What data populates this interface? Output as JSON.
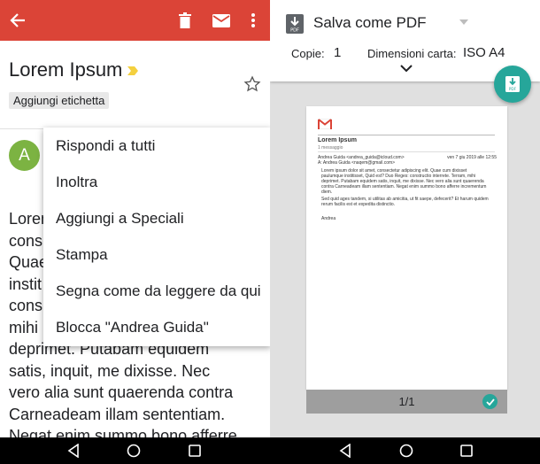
{
  "left": {
    "subject": "Lorem Ipsum",
    "label_chip": "Aggiungi etichetta",
    "avatar_letter": "A",
    "body": "Lorem\ncons\nQuae\ninstit\ncons\nmihi\ndeprimet. Putabam equidem\nsatis, inquit, me dixisse. Nec\nvero alia sunt quaerenda contra\nCarneadeam illam sententiam.\nNegat enim summo bono afferre",
    "icons": [
      "back-arrow-icon",
      "trash-icon",
      "mail-icon",
      "more-vert-icon",
      "importance-icon",
      "star-icon"
    ],
    "menu": [
      "Rispondi a tutti",
      "Inoltra",
      "Aggiungi a Speciali",
      "Stampa",
      "Segna come da leggere da qui",
      "Blocca \"Andrea Guida\""
    ],
    "colors": {
      "appbar": "#db4437",
      "avatar": "#7cb342"
    }
  },
  "right": {
    "printer": "Salva come PDF",
    "copies_label": "Copie:",
    "copies_value": "1",
    "paper_label": "Dimensioni carta:",
    "paper_value": "ISO A4",
    "preview": {
      "subject": "Lorem Ipsum",
      "count": "1 messaggio",
      "from": "Andrea Guida <andrea_guida@icloud.com>",
      "date": "ven 7 giu 2019 alle 12:55",
      "to": "A: Andrea Guida <naqem@gmail.com>",
      "para1": "Lorem ipsum dolor sit amet, consectetur adipiscing elit. Quae cum dixisset paulumque institisset, Quid est? Duo Reges: constructio interrete. Terram, mihi deprimet. Putabam equidem satis, inquit, me dixisse. Nec vero alia sunt quaerenda contra Carneadeam illam sententiam. Negat enim summo bono afferre incrementum diem.",
      "para2": "Sed quid ages tandem, si utilitas ab amicitia, ut fit saepe, defecerit? Et harum quidem rerum facilis est et expedita distinctio.",
      "signature": "Andrea"
    },
    "page_indicator": "1/1",
    "colors": {
      "accent": "#26a69a",
      "footer": "#9e9e9e"
    }
  },
  "navbar": {
    "icons": [
      "nav-back-icon",
      "nav-home-icon",
      "nav-recents-icon"
    ]
  }
}
